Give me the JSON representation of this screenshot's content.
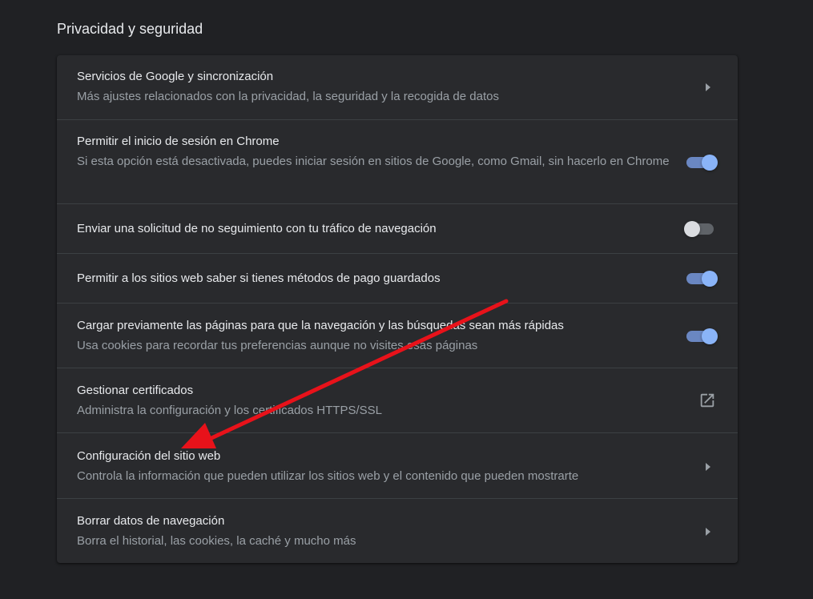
{
  "section": {
    "title": "Privacidad y seguridad"
  },
  "rows": [
    {
      "title": "Servicios de Google y sincronización",
      "subtitle": "Más ajustes relacionados con la privacidad, la seguridad y la recogida de datos",
      "control": "chevron-right-icon"
    },
    {
      "title": "Permitir el inicio de sesión en Chrome",
      "subtitle": "Si esta opción está desactivada, puedes iniciar sesión en sitios de Google, como Gmail, sin hacerlo en Chrome",
      "control": "toggle",
      "toggle_on": true
    },
    {
      "title": "Enviar una solicitud de no seguimiento con tu tráfico de navegación",
      "control": "toggle",
      "toggle_on": false
    },
    {
      "title": "Permitir a los sitios web saber si tienes métodos de pago guardados",
      "control": "toggle",
      "toggle_on": true
    },
    {
      "title": "Cargar previamente las páginas para que la navegación y las búsquedas sean más rápidas",
      "subtitle": "Usa cookies para recordar tus preferencias aunque no visites esas páginas",
      "control": "toggle",
      "toggle_on": true
    },
    {
      "title": "Gestionar certificados",
      "subtitle": "Administra la configuración y los certificados HTTPS/SSL",
      "control": "open-in-new-icon"
    },
    {
      "title": "Configuración del sitio web",
      "subtitle": "Controla la información que pueden utilizar los sitios web y el contenido que pueden mostrarte",
      "control": "chevron-right-icon"
    },
    {
      "title": "Borrar datos de navegación",
      "subtitle": "Borra el historial, las cookies, la caché y mucho más",
      "control": "chevron-right-icon"
    }
  ],
  "colors": {
    "background": "#202124",
    "card": "#292a2d",
    "divider": "#3c4043",
    "text_primary": "#e8eaed",
    "text_secondary": "#9aa0a6",
    "toggle_on_knob": "#8ab4f8",
    "toggle_on_track": "#6a87c2",
    "toggle_off_knob": "#dadce0",
    "toggle_off_track": "#5f6368",
    "annotation_arrow": "#e8121a"
  },
  "annotation": {
    "type": "red-arrow",
    "points_to": "Configuración del sitio web"
  }
}
